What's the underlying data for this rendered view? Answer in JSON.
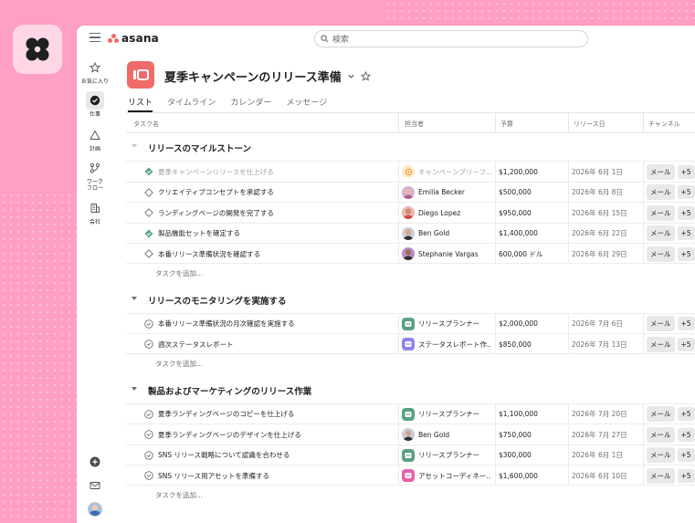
{
  "app": {
    "logo_text": "asana"
  },
  "search": {
    "placeholder": "検索"
  },
  "sidebar": {
    "items": [
      {
        "label": "お気に入り",
        "icon": "star-icon"
      },
      {
        "label": "仕事",
        "icon": "check-circle-icon"
      },
      {
        "label": "計画",
        "icon": "triangle-icon"
      },
      {
        "label": "ワーク\nフロー",
        "icon": "workflow-icon"
      },
      {
        "label": "会社",
        "icon": "building-icon"
      }
    ]
  },
  "project": {
    "title": "夏季キャンペーンのリリース準備"
  },
  "tabs": [
    "リスト",
    "タイムライン",
    "カレンダー",
    "メッセージ"
  ],
  "columns": {
    "task": "タスク名",
    "assignee": "担当者",
    "budget": "予算",
    "release": "リリース日",
    "channel": "チャンネル"
  },
  "sections": [
    {
      "title": "リリースのマイルストーン",
      "tasks": [
        {
          "name": "夏季キャンペーンリリースを仕上げる",
          "done": true,
          "assignee": "キャンペーンプリーフ...",
          "budget": "$1,200,000",
          "date": "2026年 6月 1日",
          "channel": "メール",
          "extra": "+5"
        },
        {
          "name": "クリエイティブコンセプトを承認する",
          "done": false,
          "assignee": "Emilia Becker",
          "budget": "$500,000",
          "date": "2026年 6月 8日",
          "channel": "メール",
          "extra": "+5"
        },
        {
          "name": "ランディングページの開発を完了する",
          "done": false,
          "assignee": "Diego Lopez",
          "budget": "$950,000",
          "date": "2026年 6月 15日",
          "channel": "メール",
          "extra": "+5"
        },
        {
          "name": "製品機能セットを確定する",
          "done": true,
          "assignee": "Ben Gold",
          "budget": "$1,400,000",
          "date": "2026年 6月 22日",
          "channel": "メール",
          "extra": "+5"
        },
        {
          "name": "本番リリース準備状況を確認する",
          "done": false,
          "assignee": "Stephanie Vargas",
          "budget": "600,000 ドル",
          "date": "2026年 6月 29日",
          "channel": "メール",
          "extra": "+5"
        }
      ],
      "add_task": "タスクを追加..."
    },
    {
      "title": "リリースのモニタリングを実施する",
      "tasks": [
        {
          "name": "本番リリース準備状況の月次確認を実施する",
          "done": false,
          "assignee": "リリースプランナー",
          "budget": "$2,000,000",
          "date": "2026年 7月 6日",
          "channel": "メール",
          "extra": "+5"
        },
        {
          "name": "週次ステータスレポート",
          "done": false,
          "assignee": "ステータスレポート作...",
          "budget": "$850,000",
          "date": "2026年 7月 13日",
          "channel": "メール",
          "extra": "+5"
        }
      ],
      "add_task": "タスクを追加..."
    },
    {
      "title": "製品およびマーケティングのリリース作業",
      "tasks": [
        {
          "name": "夏季ランディングページのコピーを仕上げる",
          "done": false,
          "assignee": "リリースプランナー",
          "budget": "$1,100,000",
          "date": "2026年 7月 20日",
          "channel": "メール",
          "extra": "+5"
        },
        {
          "name": "夏季ランディングページのデザインを仕上げる",
          "done": false,
          "assignee": "Ben Gold",
          "budget": "$750,000",
          "date": "2026年 7月 27日",
          "channel": "メール",
          "extra": "+5"
        },
        {
          "name": "SNS リリース戦略について認識を合わせる",
          "done": false,
          "assignee": "リリースプランナー",
          "budget": "$300,000",
          "date": "2026年 6月 1日",
          "channel": "メール",
          "extra": "+5"
        },
        {
          "name": "SNS リリース用アセットを準備する",
          "done": false,
          "assignee": "アセットコーディネー...",
          "budget": "$1,600,000",
          "date": "2026年 6月 10日",
          "channel": "メール",
          "extra": "+5"
        }
      ],
      "add_task": "タスクを追加..."
    }
  ],
  "colors": {
    "brand": "#f06a6a",
    "background": "#ff9fc4",
    "complete": "#58a182"
  }
}
